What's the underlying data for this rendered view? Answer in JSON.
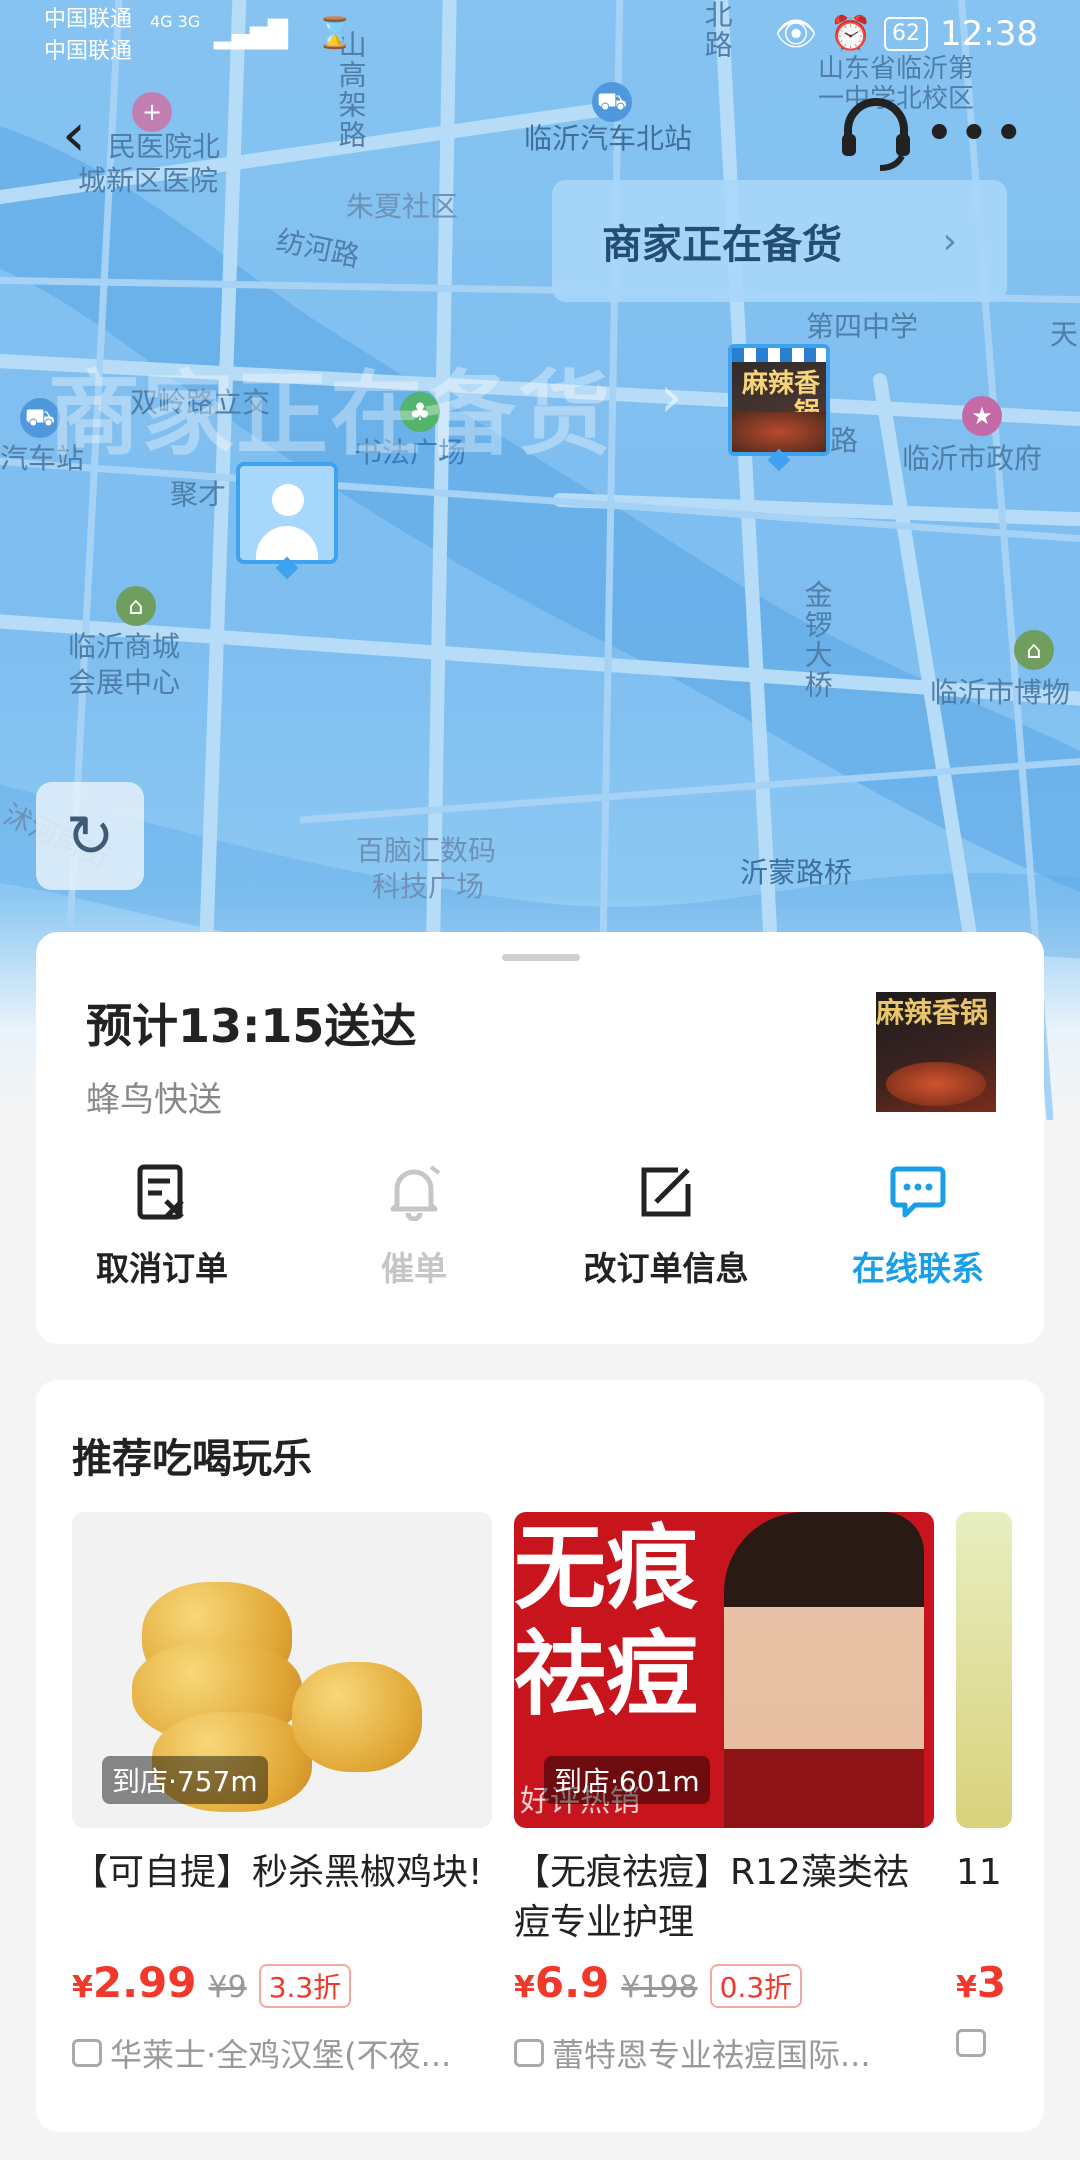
{
  "status_bar": {
    "carrier1": "中国联通",
    "carrier2": "中国联通",
    "network": "4G 3G",
    "battery": "62",
    "time": "12:38"
  },
  "map": {
    "labels": [
      "民医院北",
      "城新区医院",
      "临沂汽车北站",
      "山东省临沂第",
      "一中学北校区",
      "朱夏社区",
      "纺河路",
      "第四中学",
      "天",
      "双岭路立交",
      "书法广场",
      "汽车站",
      "聚才",
      "路",
      "临沂市政府",
      "临沂商城",
      "会展中心",
      "临沂市博物",
      "百脑汇数码",
      "科技广场",
      "沂蒙路桥",
      "沭河南街"
    ],
    "vertical_labels": [
      "山高架路",
      "金锣大桥",
      "北路"
    ],
    "ghost_status": "商家正在备货",
    "status_bubble": "商家正在备货",
    "store_pin_text": "麻辣香锅"
  },
  "delivery": {
    "eta": "预计13:15送达",
    "courier": "蜂鸟快送",
    "thumb_text": "麻辣香锅"
  },
  "actions": [
    {
      "label": "取消订单",
      "icon": "cancel-order-icon"
    },
    {
      "label": "催单",
      "icon": "bell-icon"
    },
    {
      "label": "改订单信息",
      "icon": "edit-icon"
    },
    {
      "label": "在线联系",
      "icon": "chat-icon"
    }
  ],
  "recommend": {
    "title": "推荐吃喝玩乐",
    "items": [
      {
        "distance": "到店·757m",
        "name": "【可自提】秒杀黑椒鸡块!",
        "price": "2.99",
        "currency": "¥",
        "original": "¥9",
        "discount": "3.3折",
        "shop": "华莱士·全鸡汉堡(不夜..."
      },
      {
        "distance": "到店·601m",
        "name": "【无痕祛痘】R12藻类祛痘专业护理",
        "price": "6.9",
        "currency": "¥",
        "original": "¥198",
        "discount": "0.3折",
        "shop": "蕾特恩专业祛痘国际...",
        "img_text": "无痕祛痘",
        "img_sub": "好评热销"
      },
      {
        "name": "11",
        "currency": "¥",
        "price": "3"
      }
    ]
  },
  "colors": {
    "accent": "#1a9ee8",
    "price": "#f0392b",
    "map_water": "#5aa6e6"
  }
}
